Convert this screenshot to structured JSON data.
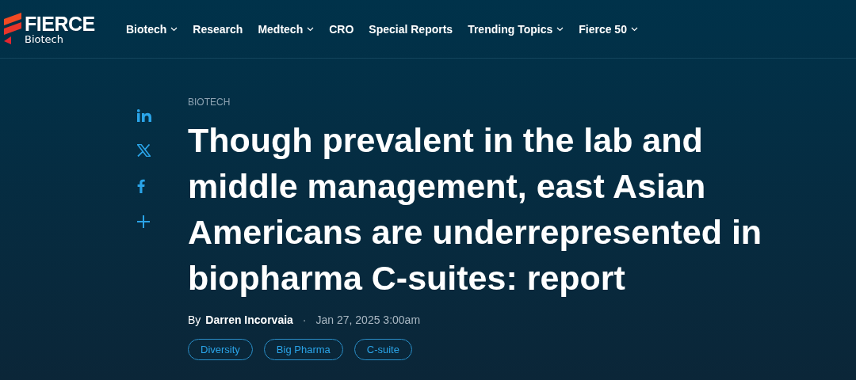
{
  "logo": {
    "brand": "FIERCE",
    "section": "Biotech"
  },
  "nav": [
    {
      "label": "Biotech",
      "dropdown": true
    },
    {
      "label": "Research",
      "dropdown": false
    },
    {
      "label": "Medtech",
      "dropdown": true
    },
    {
      "label": "CRO",
      "dropdown": false
    },
    {
      "label": "Special Reports",
      "dropdown": false
    },
    {
      "label": "Trending Topics",
      "dropdown": true
    },
    {
      "label": "Fierce 50",
      "dropdown": true
    }
  ],
  "share": [
    {
      "kind": "linkedin"
    },
    {
      "kind": "x"
    },
    {
      "kind": "facebook"
    },
    {
      "kind": "more"
    }
  ],
  "article": {
    "category": "BIOTECH",
    "title": "Though prevalent in the lab and middle management, east Asian Americans are underrepresented in biopharma C-suites: report",
    "byline_prefix": "By",
    "author": "Darren Incorvaia",
    "separator": "·",
    "date": "Jan 27, 2025 3:00am",
    "tags": [
      "Diversity",
      "Big Pharma",
      "C-suite"
    ]
  }
}
